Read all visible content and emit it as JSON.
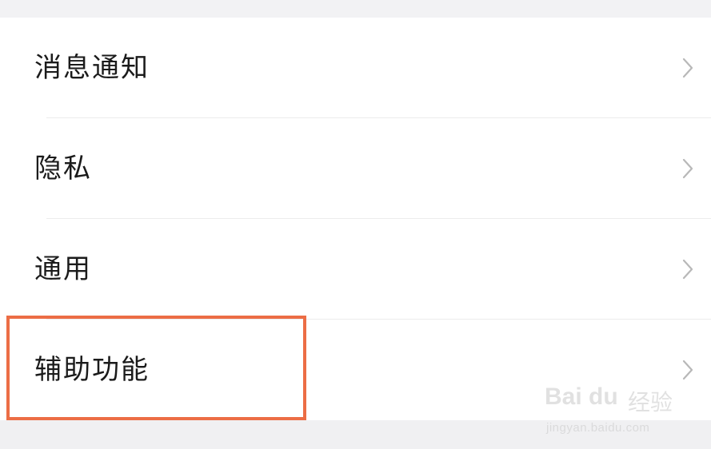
{
  "settings": {
    "items": [
      {
        "label": "消息通知",
        "icon": "chevron-right-icon"
      },
      {
        "label": "隐私",
        "icon": "chevron-right-icon"
      },
      {
        "label": "通用",
        "icon": "chevron-right-icon"
      },
      {
        "label": "辅助功能",
        "icon": "chevron-right-icon"
      }
    ]
  },
  "annotation": {
    "highlighted_item": "辅助功能",
    "color": "#ec6d45"
  },
  "watermark": {
    "logo": "Bai du",
    "brand": "经验",
    "url": "jingyan.baidu.com"
  },
  "colors": {
    "background": "#f3f3f3",
    "row_background": "#ffffff",
    "text": "#1b1b1b",
    "chevron": "#b8b8b8",
    "divider": "#ececec"
  }
}
